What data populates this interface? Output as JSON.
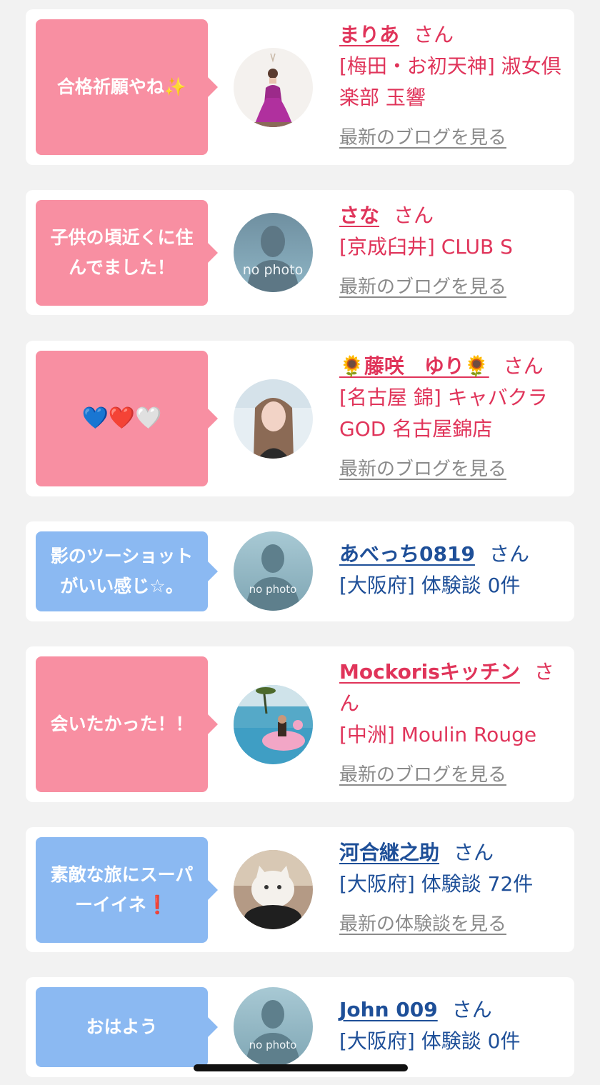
{
  "colors": {
    "background": "#f2f2f2",
    "card": "#ffffff",
    "bubble_pink": "#f88fa2",
    "bubble_blue": "#8bb9f2",
    "text_pink": "#e0345a",
    "text_blue": "#1e4f98",
    "link_gray": "#8a8a8a"
  },
  "comments": [
    {
      "message": "合格祈願やね✨",
      "type": "cast",
      "avatar": "woman-purple-dress-photo",
      "name": "まりあ",
      "honorific": "さん",
      "shop": "[梅田・お初天神] 淑女倶楽部 玉響",
      "link": "最新のブログを見る"
    },
    {
      "message": "子供の頃近くに住んでました！",
      "type": "cast",
      "avatar": "no-photo-placeholder",
      "avatar_text": "no photo",
      "name": "さな",
      "honorific": "さん",
      "shop": "[京成臼井] CLUB S",
      "link": "最新のブログを見る"
    },
    {
      "message": "💙❤️🤍",
      "type": "cast",
      "avatar": "woman-selfie-photo",
      "name": "🌻藤咲　ゆり🌻",
      "honorific": "さん",
      "shop": "[名古屋 錦] キャバクラ GOD 名古屋錦店",
      "link": "最新のブログを見る"
    },
    {
      "message": "影のツーショットがいい感じ☆。",
      "type": "user",
      "avatar": "no-photo-placeholder",
      "avatar_text": "no photo",
      "name": "あべっち0819",
      "honorific": "さん",
      "shop": "[大阪府] 体験談 0件",
      "link": ""
    },
    {
      "message": "会いたかった！！",
      "type": "cast",
      "avatar": "pool-flamingo-photo",
      "name": "Mockorisキッチン",
      "honorific": "さん",
      "shop": "[中洲] Moulin Rouge",
      "link": "最新のブログを見る"
    },
    {
      "message": "素敵な旅にスーパーイイネ❗️",
      "type": "user",
      "avatar": "cat-plush-photo",
      "name": "河合継之助",
      "honorific": "さん",
      "shop": "[大阪府] 体験談 72件",
      "link": "最新の体験談を見る"
    },
    {
      "message": "おはよう",
      "type": "user",
      "avatar": "no-photo-placeholder",
      "avatar_text": "no photo",
      "name": "John 009",
      "honorific": "さん",
      "shop": "[大阪府] 体験談 0件",
      "link": ""
    }
  ]
}
